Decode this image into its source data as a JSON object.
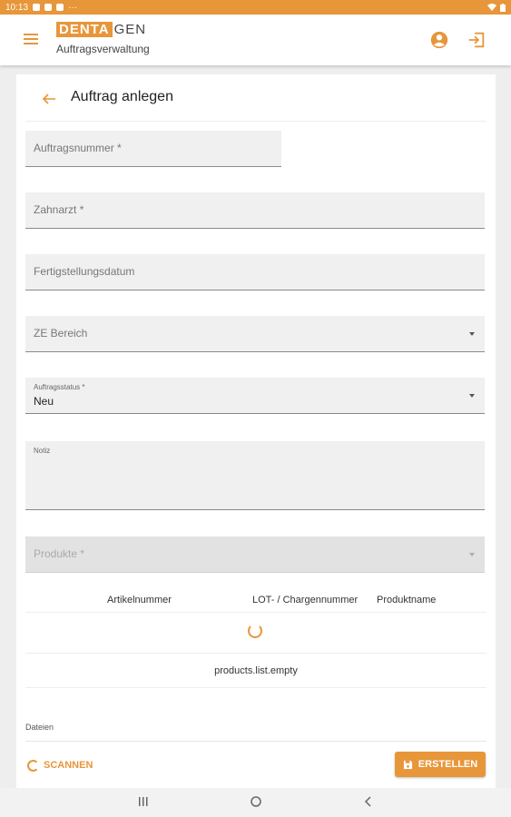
{
  "status_bar": {
    "time": "10:13",
    "dots": "···"
  },
  "app_bar": {
    "logo_highlight": "DENTA",
    "logo_rest": "GEN",
    "subtitle": "Auftragsverwaltung",
    "account_icon": "account-circle-icon",
    "logout_icon": "logout-icon",
    "accent_color": "#e8963a"
  },
  "card": {
    "title": "Auftrag anlegen"
  },
  "form": {
    "order_number_label": "Auftragsnummer *",
    "dentist_label": "Zahnarzt *",
    "completion_date_label": "Fertigstellungsdatum",
    "ze_area_label": "ZE Bereich",
    "order_status_label": "Auftragsstatus *",
    "order_status_value": "Neu",
    "note_label": "Notiz",
    "products_label": "Produkte *"
  },
  "products_table": {
    "columns": [
      "Artikelnummer",
      "LOT- / Chargennummer",
      "Produktname"
    ],
    "empty_text": "products.list.empty"
  },
  "files_label": "Dateien",
  "actions": {
    "scan_label": "SCANNEN",
    "create_label": "ERSTELLEN"
  }
}
